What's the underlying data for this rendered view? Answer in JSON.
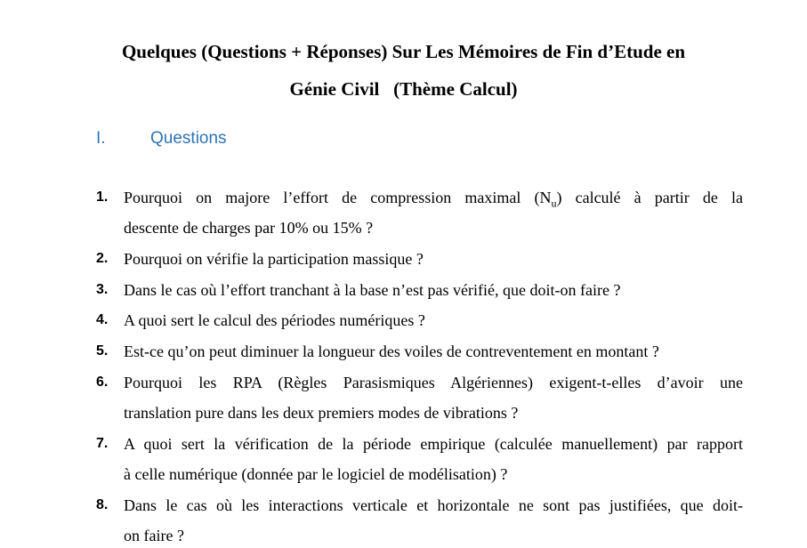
{
  "document": {
    "title_line1": "Quelques (Questions + Réponses) Sur Les Mémoires de Fin d’Etude en",
    "title_line2": "Génie Civil   (Thème Calcul)",
    "section_number": "I.",
    "section_title": "Questions",
    "questions": [
      {
        "number": "1.",
        "line1_before": "Pourquoi on majore l’effort de compression maximal (N",
        "line1_sub": "u",
        "line1_after": ") calculé à partir de la",
        "line2": "descente de charges par 10% ou 15% ?"
      },
      {
        "number": "2.",
        "line1": "Pourquoi on vérifie la participation massique ?"
      },
      {
        "number": "3.",
        "line1": "Dans le cas où l’effort tranchant à la base n’est pas vérifié, que doit-on faire ?"
      },
      {
        "number": "4.",
        "line1": "A quoi sert le calcul des périodes numériques ?"
      },
      {
        "number": "5.",
        "line1": "Est-ce qu’on peut diminuer la longueur des voiles de contreventement en montant ?"
      },
      {
        "number": "6.",
        "line1": "Pourquoi les RPA (Règles Parasismiques Algériennes) exigent-t-elles d’avoir une",
        "line2": "translation pure dans les deux premiers modes de vibrations ?"
      },
      {
        "number": "7.",
        "line1": "A quoi sert la vérification de la période empirique (calculée manuellement) par rapport",
        "line2": "à celle numérique (donnée par le logiciel de modélisation) ?"
      },
      {
        "number": "8.",
        "line1": "Dans le cas où les interactions verticale et horizontale ne sont pas justifiées, que doit-",
        "line2": "on faire ?"
      }
    ]
  }
}
